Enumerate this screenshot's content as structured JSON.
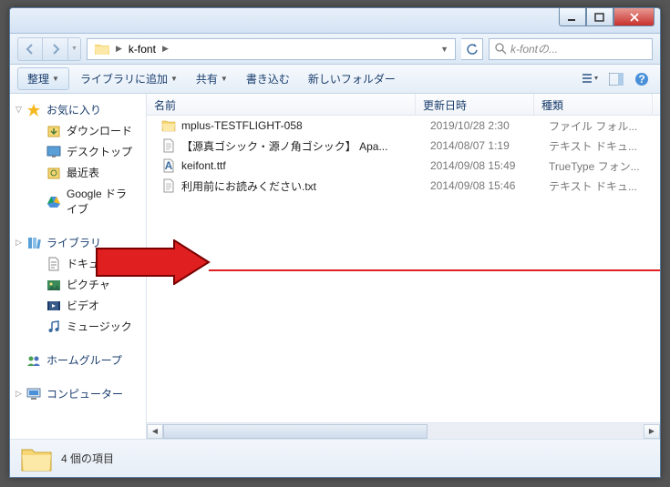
{
  "breadcrumb": {
    "folder": "k-font"
  },
  "search": {
    "placeholder": "k-fontの..."
  },
  "toolbar": {
    "organize": "整理",
    "library": "ライブラリに追加",
    "share": "共有",
    "burn": "書き込む",
    "newfolder": "新しいフォルダー"
  },
  "sidebar": {
    "favorites": {
      "label": "お気に入り",
      "items": [
        "ダウンロード",
        "デスクトップ",
        "最近表",
        "Google ドライブ"
      ]
    },
    "libraries": {
      "label": "ライブラリ",
      "items": [
        "ドキュメント",
        "ピクチャ",
        "ビデオ",
        "ミュージック"
      ]
    },
    "homegroup": {
      "label": "ホームグループ"
    },
    "computer": {
      "label": "コンピューター"
    }
  },
  "columns": {
    "name": "名前",
    "date": "更新日時",
    "type": "種類",
    "widths": {
      "name": 295,
      "date": 130,
      "type": 130
    }
  },
  "files": [
    {
      "name": "mplus-TESTFLIGHT-058",
      "date": "2019/10/28 2:30",
      "type": "ファイル フォル...",
      "icon": "folder"
    },
    {
      "name": "【源真ゴシック・源ノ角ゴシック】 Apa...",
      "date": "2014/08/07 1:19",
      "type": "テキスト ドキュ...",
      "icon": "txt"
    },
    {
      "name": "keifont.ttf",
      "date": "2014/09/08 15:49",
      "type": "TrueType フォン...",
      "icon": "font"
    },
    {
      "name": "利用前にお読みください.txt",
      "date": "2014/09/08 15:46",
      "type": "テキスト ドキュ...",
      "icon": "txt"
    }
  ],
  "status": {
    "count": "4 個の項目"
  }
}
